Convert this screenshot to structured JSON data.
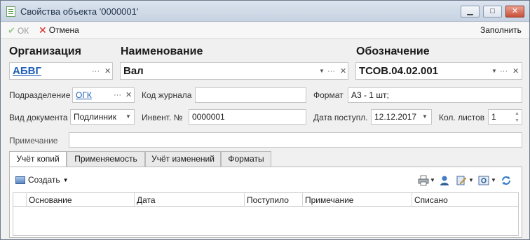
{
  "window": {
    "title": "Свойства объекта '0000001'"
  },
  "toolbar": {
    "ok": "ОК",
    "cancel": "Отмена",
    "fill": "Заполнить"
  },
  "org": {
    "label": "Организация",
    "value": "АБВГ"
  },
  "name": {
    "label": "Наименование",
    "value": "Вал"
  },
  "designation": {
    "label": "Обозначение",
    "value": "ТСОВ.04.02.001"
  },
  "subdivision": {
    "label": "Подразделение",
    "value": "ОГК"
  },
  "journal": {
    "label": "Код журнала",
    "value": ""
  },
  "format": {
    "label": "Формат",
    "value": "А3 - 1 шт;"
  },
  "doctype": {
    "label": "Вид документа",
    "value": "Подлинник"
  },
  "inv": {
    "label": "Инвент. №",
    "value": "0000001"
  },
  "received_date": {
    "label": "Дата поступл.",
    "value": "12.12.2017"
  },
  "sheets": {
    "label": "Кол. листов",
    "value": "1"
  },
  "note": {
    "label": "Примечание",
    "value": ""
  },
  "tabs": [
    "Учёт копий",
    "Применяемость",
    "Учёт изменений",
    "Форматы"
  ],
  "panel": {
    "create": "Создать"
  },
  "grid": {
    "columns": [
      "Основание",
      "Дата",
      "Поступило",
      "Примечание",
      "Списано"
    ]
  }
}
